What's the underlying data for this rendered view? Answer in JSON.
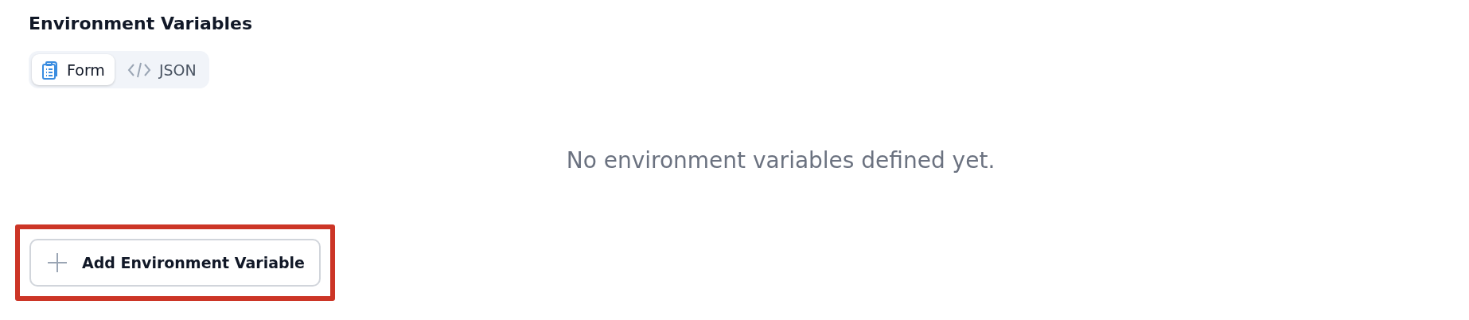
{
  "title": "Environment Variables",
  "view_tabs": [
    {
      "label": "Form",
      "kind": "form",
      "selected": true
    },
    {
      "label": "JSON",
      "kind": "code",
      "selected": false
    }
  ],
  "empty_message": "No environment variables defined yet.",
  "add_button": {
    "label": "Add Environment Variable",
    "highlighted": true
  }
}
